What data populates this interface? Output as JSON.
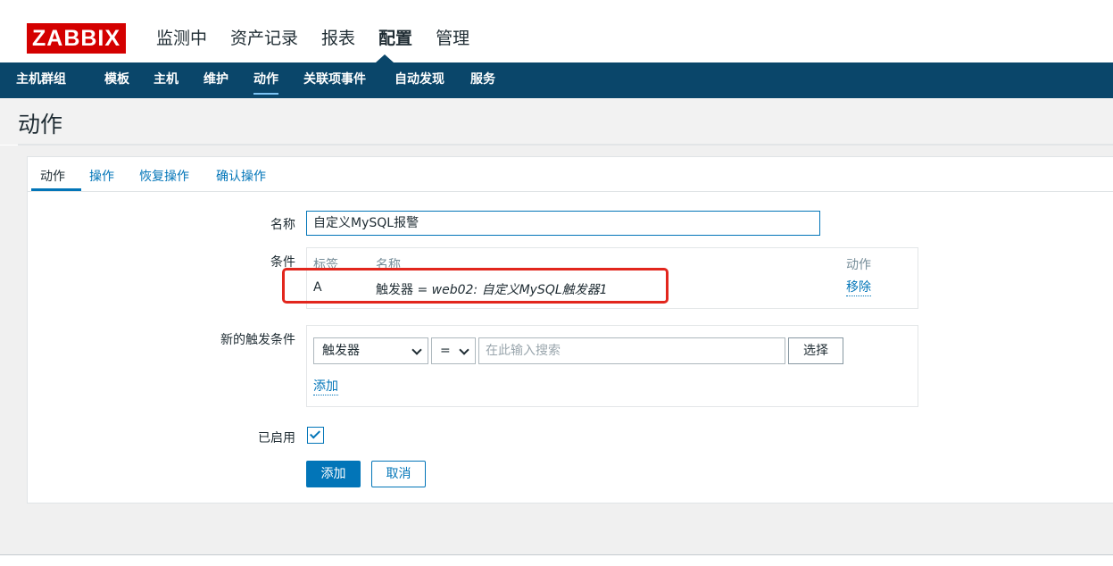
{
  "header": {
    "logo": "ZABBIX",
    "main_menu": [
      "监测中",
      "资产记录",
      "报表",
      "配置",
      "管理"
    ],
    "active_main": "配置"
  },
  "subnav": {
    "items": [
      "主机群组",
      "模板",
      "主机",
      "维护",
      "动作",
      "关联项事件",
      "自动发现",
      "服务"
    ],
    "active": "动作"
  },
  "page": {
    "title": "动作"
  },
  "tabs": [
    "动作",
    "操作",
    "恢复操作",
    "确认操作"
  ],
  "form": {
    "name_label": "名称",
    "name_value": "自定义MySQL报警",
    "conditions_label": "条件",
    "conditions": {
      "headers": {
        "label": "标签",
        "name": "名称",
        "action": "动作"
      },
      "rows": [
        {
          "label": "A",
          "field": "触发器 = ",
          "value": "web02: 自定义MySQL触发器1",
          "action": "移除"
        }
      ]
    },
    "new_condition_label": "新的触发条件",
    "new_condition": {
      "type": "触发器",
      "operator": "=",
      "search_placeholder": "在此输入搜索",
      "select_button": "选择",
      "add_link": "添加"
    },
    "enabled_label": "已启用",
    "enabled": true,
    "submit_button": "添加",
    "cancel_button": "取消"
  },
  "colors": {
    "brand": "#d40000",
    "nav_bg": "#0a466a",
    "link": "#0275b8",
    "highlight": "#e2261d"
  }
}
